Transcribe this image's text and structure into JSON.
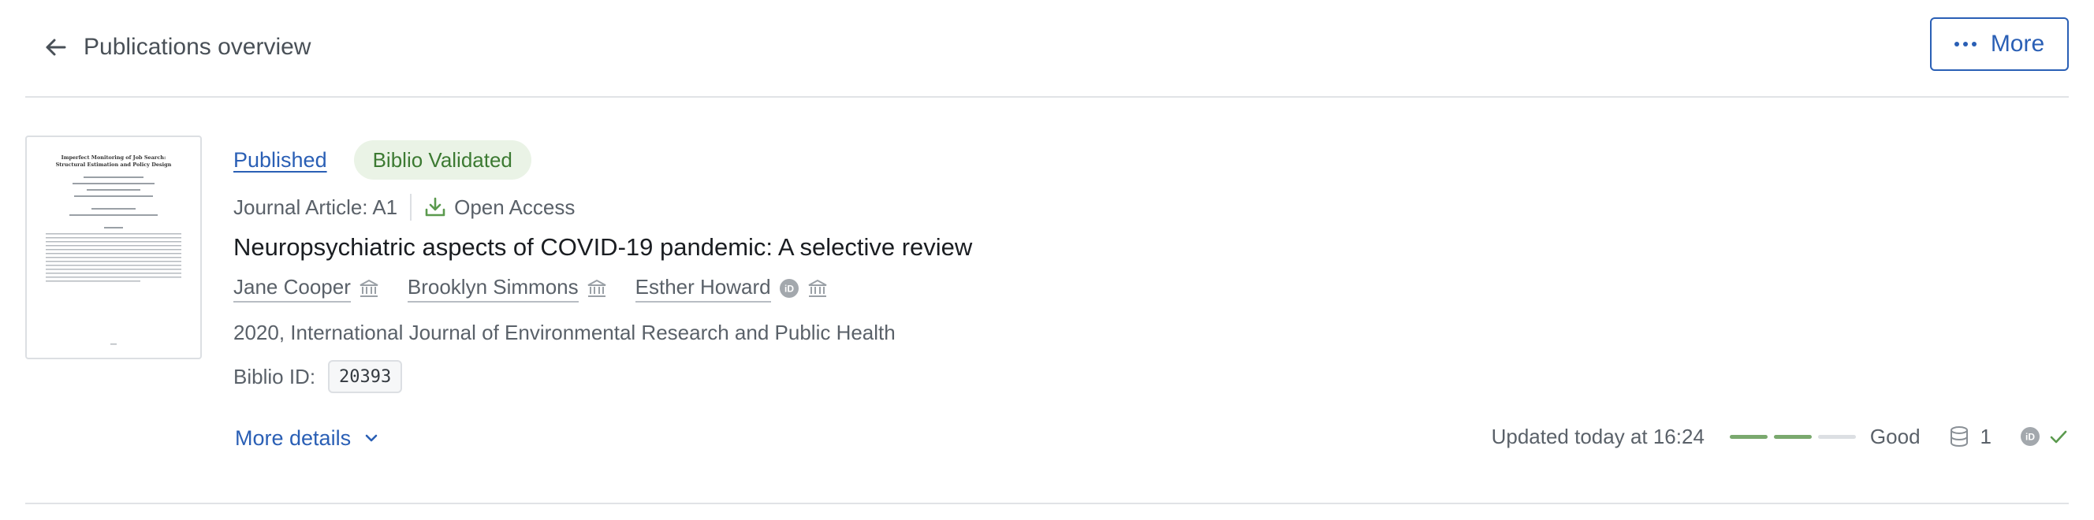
{
  "header": {
    "title": "Publications overview",
    "more_label": "More"
  },
  "publication": {
    "status": "Published",
    "validation_badge": "Biblio Validated",
    "type": "Journal Article: A1",
    "access": "Open Access",
    "title": "Neuropsychiatric aspects of COVID-19 pandemic: A selective review",
    "authors": [
      {
        "name": "Jane Cooper",
        "orcid": false
      },
      {
        "name": "Brooklyn Simmons",
        "orcid": false
      },
      {
        "name": "Esther Howard",
        "orcid": true
      }
    ],
    "source": "2020, International Journal of Environmental Research and Public Health",
    "biblio_id_label": "Biblio ID:",
    "biblio_id": "20393",
    "more_details": "More details",
    "updated": "Updated today at 16:24",
    "quality": {
      "label": "Good",
      "level": 2,
      "max": 3
    },
    "datasource_count": "1",
    "thumbnail": {
      "title_line_1": "Imperfect Monitoring of Job Search:",
      "title_line_2": "Structural Estimation and Policy Design"
    }
  },
  "colors": {
    "link": "#2a5fb5",
    "badge_bg": "#eaf3e6",
    "badge_text": "#3c7a32",
    "quality_on": "#7aa96e",
    "quality_off": "#dcdfe3"
  },
  "icons": {
    "back": "arrow-left-icon",
    "more": "ellipsis-icon",
    "open_access": "download-icon",
    "affiliation": "institution-icon",
    "orcid": "orcid-icon",
    "chevron": "chevron-down-icon",
    "database": "database-icon",
    "check": "check-icon"
  }
}
